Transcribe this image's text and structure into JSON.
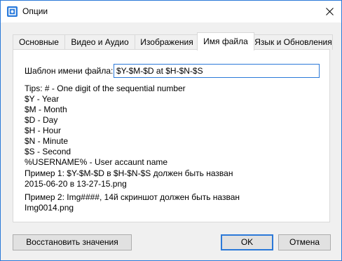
{
  "window": {
    "title": "Опции"
  },
  "tabs": [
    {
      "label": "Основные"
    },
    {
      "label": "Видео и Аудио"
    },
    {
      "label": "Изображения"
    },
    {
      "label": "Имя файла"
    },
    {
      "label": "Язык и Обновления"
    }
  ],
  "active_tab_index": 3,
  "filename": {
    "template_label": "Шаблон имени файла:",
    "template_value": "$Y-$M-$D at $H-$N-$S",
    "tips": [
      "Tips: # - One digit of the sequential number",
      "$Y - Year",
      "$M - Month",
      "$D - Day",
      "$H - Hour",
      "$N - Minute",
      "$S - Second",
      "%USERNAME% - User accaunt name"
    ],
    "example1_line1": "Пример 1: $Y-$M-$D в $H-$N-$S должен быть назван",
    "example1_line2": "2015-06-20 в 13-27-15.png",
    "example2_line1": "Пример 2: Img####, 14й скриншот должен быть назван",
    "example2_line2": "Img0014.png"
  },
  "buttons": {
    "restore": "Восстановить значения",
    "ok": "OK",
    "cancel": "Отмена"
  },
  "colors": {
    "accent": "#2b79d8",
    "dialog_bg": "#f0f0f0",
    "button_bg": "#e1e1e1"
  },
  "icons": {
    "app": "screenshot-app-icon",
    "close": "close-icon"
  }
}
